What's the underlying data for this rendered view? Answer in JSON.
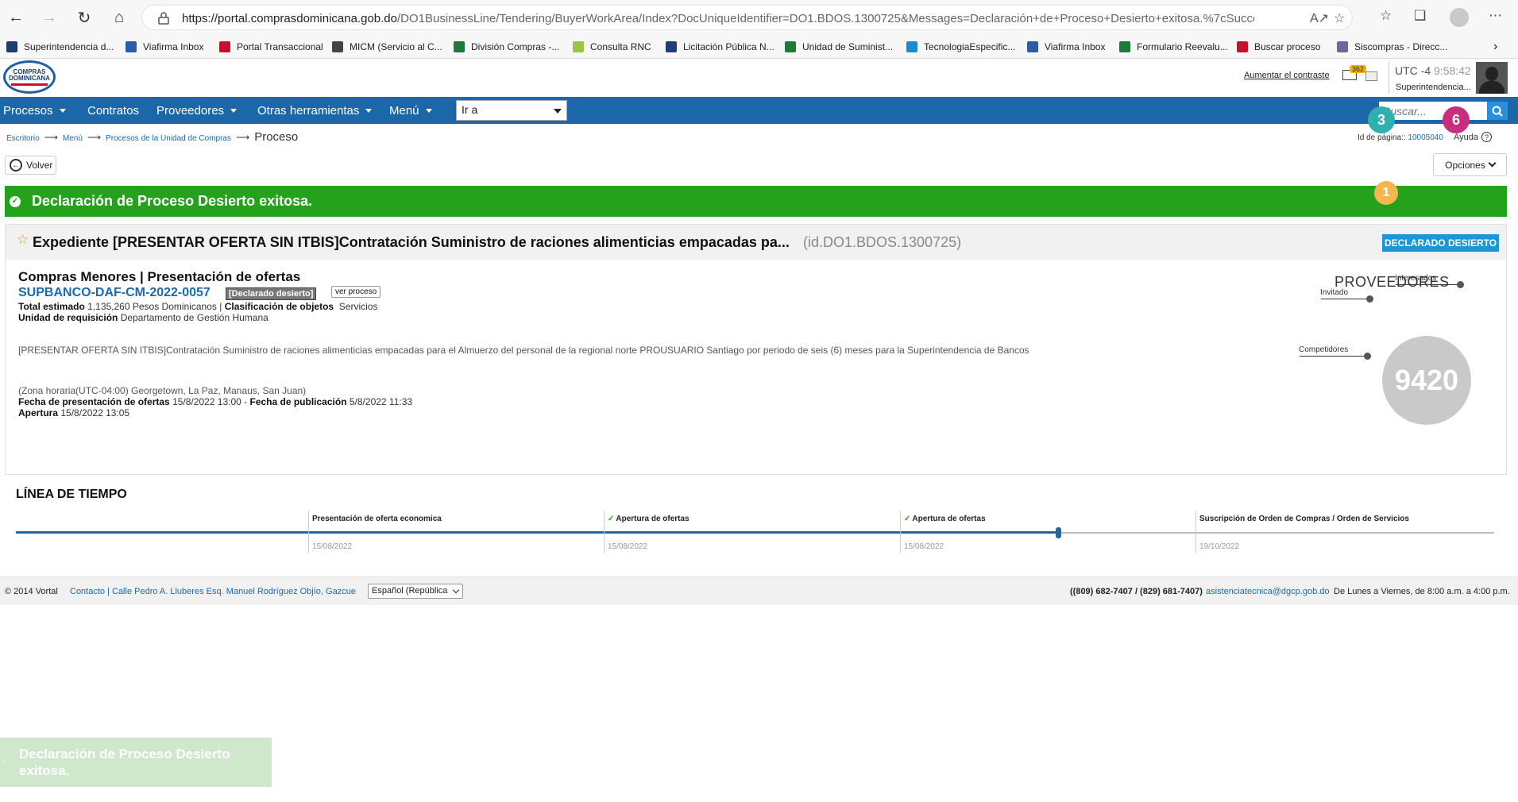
{
  "browser": {
    "url_host": "https://portal.comprasdominicana.gob.do",
    "url_path": "/DO1BusinessLine/Tendering/BuyerWorkArea/Index?DocUniqueIdentifier=DO1.BDOS.1300725&Messages=Declaración+de+Proceso+Desierto+exitosa.%7cSuccess%7cSuccess&Message...",
    "bookmarks": [
      {
        "label": "Superintendencia d...",
        "color": "#1d3d70"
      },
      {
        "label": "Viafirma Inbox",
        "color": "#2a5ca8"
      },
      {
        "label": "Portal Transaccional",
        "color": "#c8102e"
      },
      {
        "label": "MICM (Servicio al C...",
        "color": "#444444"
      },
      {
        "label": "División Compras -...",
        "color": "#1e7a3a"
      },
      {
        "label": "Consulta RNC",
        "color": "#9bc53d"
      },
      {
        "label": "Licitación Pública N...",
        "color": "#1c3f7a"
      },
      {
        "label": "Unidad de Suminist...",
        "color": "#1e7a3a"
      },
      {
        "label": "TecnologiaEspecific...",
        "color": "#1a8ad4"
      },
      {
        "label": "Viafirma Inbox",
        "color": "#2a5ca8"
      },
      {
        "label": "Formulario Reevalu...",
        "color": "#1e7a3a"
      },
      {
        "label": "Buscar proceso",
        "color": "#c8102e"
      },
      {
        "label": "Siscompras - Direcc...",
        "color": "#6a6a9a"
      }
    ]
  },
  "header": {
    "logo_line1": "COMPRAS",
    "logo_line2": "DOMINICANA",
    "contrast_link": "Aumentar el contraste",
    "mail_badge": "362",
    "timezone": "UTC -4",
    "clock": "9:58:42",
    "org_name": "Superintendencia..."
  },
  "nav": {
    "items": [
      {
        "label": "Procesos",
        "dropdown": true
      },
      {
        "label": "Contratos",
        "dropdown": false
      },
      {
        "label": "Proveedores",
        "dropdown": true
      },
      {
        "label": "Otras herramientas",
        "dropdown": true
      },
      {
        "label": "Menú",
        "dropdown": true
      }
    ],
    "goto_value": "Ir a",
    "search_placeholder": "Buscar..."
  },
  "breadcrumb": {
    "items": [
      "Escritorio",
      "Menú",
      "Procesos de la Unidad de Compras"
    ],
    "current": "Proceso",
    "page_id_label": "Id de página::",
    "page_id_value": "10005040",
    "help_label": "Ayuda"
  },
  "actions": {
    "back_label": "Volver",
    "options_label": "Opciones"
  },
  "banner": {
    "message": "Declaración de Proceso Desierto exitosa."
  },
  "expediente": {
    "title": "Expediente  [PRESENTAR OFERTA SIN ITBIS]Contratación Suministro de raciones alimenticias empacadas pa...",
    "id": "(id.DO1.BDOS.1300725)",
    "status_tag": "DECLARADO DESIERTO",
    "process_type": "Compras Menores | Presentación de ofertas",
    "code": "SUPBANCO-DAF-CM-2022-0057",
    "process_status": "[Declarado desierto]",
    "view_process": "ver proceso",
    "total_label": "Total estimado",
    "total_value": "1,135,260 Pesos Dominicanos",
    "class_label": "Clasificación de objetos",
    "class_value": "Servicios",
    "unit_label": "Unidad de requisición",
    "unit_value": "Departamento de Gestión Humana",
    "description": "[PRESENTAR OFERTA SIN ITBIS]Contratación Suministro de raciones alimenticias empacadas para el Almuerzo del personal de la regional norte PROUSUARIO Santiago por periodo de seis (6) meses para la Superintendencia de Bancos",
    "timezone_note": "(Zona horaria(UTC-04:00) Georgetown, La Paz, Manaus, San Juan)",
    "presentation_label": "Fecha de presentación de ofertas",
    "presentation_value": "15/8/2022 13:00",
    "publication_label": "Fecha de publicación",
    "publication_value": "5/8/2022 11:33",
    "opening_label": "Apertura",
    "opening_value": "15/8/2022 13:05"
  },
  "proveedores": {
    "title": "PROVEEDORES",
    "total": "9420",
    "invitado_label": "Invitado",
    "invitado_count": "3",
    "interesados_label": "Interesados",
    "interesados_count": "6",
    "competidores_label": "Competidores",
    "competidores_count": "1",
    "colors": {
      "invitado": "#2fb0b0",
      "interesados": "#c72e7d",
      "competidores": "#f4b64f",
      "total": "#c9c9c9"
    }
  },
  "timeline": {
    "title": "LÍNEA DE TIEMPO",
    "progress_fraction": 0.705,
    "steps": [
      {
        "label": "Presentación de oferta economica",
        "date": "15/08/2022",
        "done": false
      },
      {
        "label": "Apertura de ofertas",
        "date": "15/08/2022",
        "done": true
      },
      {
        "label": "Apertura de ofertas",
        "date": "15/08/2022",
        "done": true
      },
      {
        "label": "Suscripción de Orden de Compras / Orden de Servicios",
        "date": "19/10/2022",
        "done": false
      }
    ]
  },
  "footer": {
    "copyright": "© 2014 Vortal",
    "contact": "Contacto | Calle Pedro A. Lluberes Esq. Manuel Rodríguez Objío, Gazcue",
    "language": "Español (República",
    "phones": "((809) 682-7407 / (829) 681-7407)",
    "email": "asistenciatecnica@dgcp.gob.do",
    "hours": "De Lunes a Viernes, de 8:00 a.m. a 4:00 p.m."
  },
  "toast": {
    "message": "Declaración de Proceso Desierto exitosa."
  }
}
